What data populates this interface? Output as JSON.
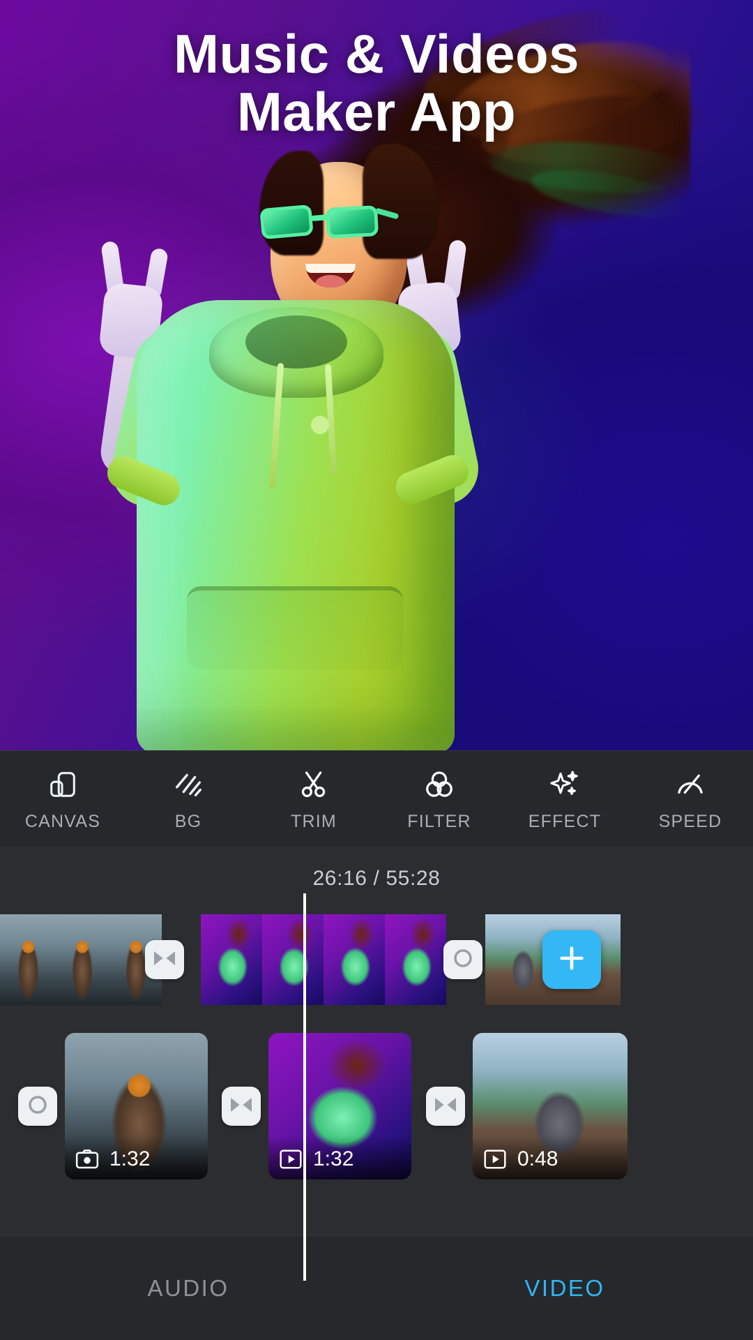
{
  "hero": {
    "title_line1": "Music & Videos",
    "title_line2": "Maker App"
  },
  "toolbar": {
    "items": [
      {
        "label": "CANVAS",
        "icon": "canvas-icon"
      },
      {
        "label": "BG",
        "icon": "background-stripes-icon"
      },
      {
        "label": "TRIM",
        "icon": "scissors-icon"
      },
      {
        "label": "FILTER",
        "icon": "three-circles-icon"
      },
      {
        "label": "EFFECT",
        "icon": "sparkles-icon"
      },
      {
        "label": "SPEED",
        "icon": "speedometer-icon"
      }
    ]
  },
  "timeline": {
    "current_time": "26:16",
    "total_time": "55:28",
    "timecode": "26:16 / 55:28",
    "separator": "/",
    "add_button_label": "+",
    "transition_buttons": [
      {
        "type": "crossfade",
        "icon": "bowtie-transition-icon"
      },
      {
        "type": "none",
        "icon": "circle-no-transition-icon"
      }
    ],
    "clips": [
      {
        "thumb": "street-portrait",
        "duration": "1:32",
        "media_type": "photo",
        "icon": "camera-icon"
      },
      {
        "thumb": "neon-dancer",
        "duration": "1:32",
        "media_type": "video",
        "icon": "play-icon"
      },
      {
        "thumb": "lake-headphones",
        "duration": "0:48",
        "media_type": "video",
        "icon": "play-icon"
      }
    ]
  },
  "tabs": {
    "audio_label": "AUDIO",
    "video_label": "VIDEO"
  },
  "colors": {
    "accent": "#30b6f2",
    "add_button": "#33b8f5",
    "panel": "#26282c",
    "timeline_bg": "#2b2d31",
    "inactive_text": "#8d939a",
    "playhead": "#ffffff"
  }
}
